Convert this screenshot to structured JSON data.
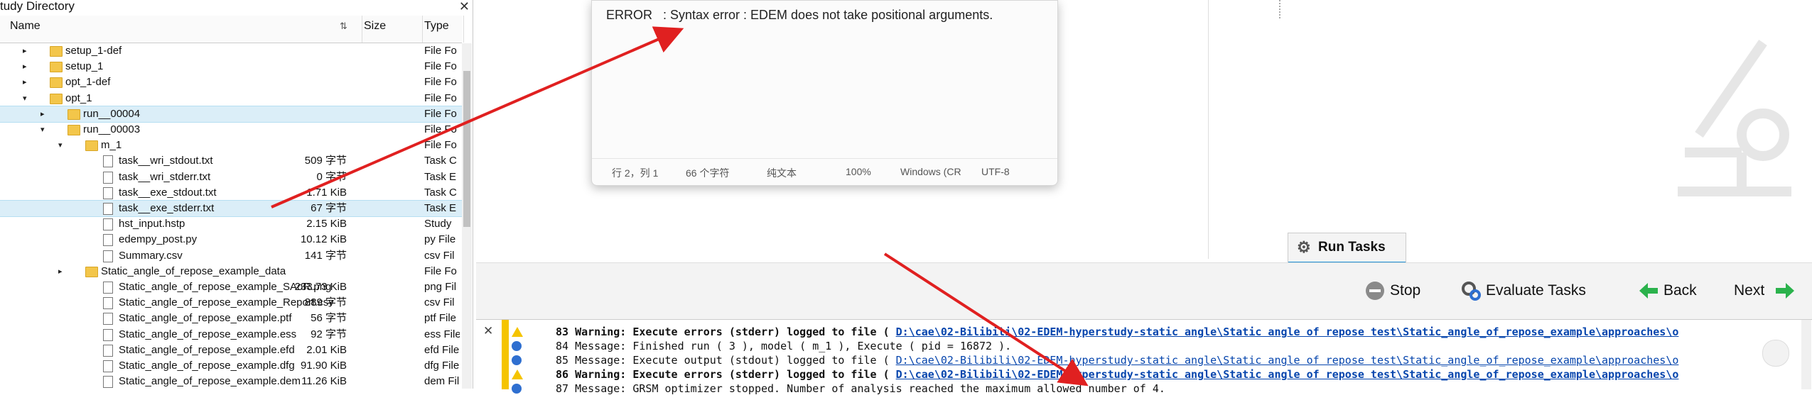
{
  "study_panel": {
    "title": "tudy Directory",
    "close_glyph": "✕",
    "columns": [
      "Name",
      "Size",
      "Type"
    ],
    "rows": [
      {
        "depth": 0,
        "toggle": "▸",
        "icon": "folder",
        "name": "setup_1-def",
        "size": "",
        "type": "File Fo"
      },
      {
        "depth": 0,
        "toggle": "▸",
        "icon": "folder",
        "name": "setup_1",
        "size": "",
        "type": "File Fo"
      },
      {
        "depth": 0,
        "toggle": "▸",
        "icon": "folder",
        "name": "opt_1-def",
        "size": "",
        "type": "File Fo"
      },
      {
        "depth": 0,
        "toggle": "▾",
        "icon": "folder",
        "name": "opt_1",
        "size": "",
        "type": "File Fo"
      },
      {
        "depth": 1,
        "toggle": "▸",
        "icon": "folder",
        "name": "run__00004",
        "size": "",
        "type": "File Fo",
        "selected": true
      },
      {
        "depth": 1,
        "toggle": "▾",
        "icon": "folder",
        "name": "run__00003",
        "size": "",
        "type": "File Fo"
      },
      {
        "depth": 2,
        "toggle": "▾",
        "icon": "folder",
        "name": "m_1",
        "size": "",
        "type": "File Fo"
      },
      {
        "depth": 3,
        "toggle": "",
        "icon": "file",
        "name": "task__wri_stdout.txt",
        "size": "509 字节",
        "type": "Task C"
      },
      {
        "depth": 3,
        "toggle": "",
        "icon": "file",
        "name": "task__wri_stderr.txt",
        "size": "0 字节",
        "type": "Task E"
      },
      {
        "depth": 3,
        "toggle": "",
        "icon": "file",
        "name": "task__exe_stdout.txt",
        "size": "1.71 KiB",
        "type": "Task C"
      },
      {
        "depth": 3,
        "toggle": "",
        "icon": "file",
        "name": "task__exe_stderr.txt",
        "size": "67 字节",
        "type": "Task E",
        "selected": true
      },
      {
        "depth": 3,
        "toggle": "",
        "icon": "file",
        "name": "hst_input.hstp",
        "size": "2.15 KiB",
        "type": "Study"
      },
      {
        "depth": 3,
        "toggle": "",
        "icon": "file",
        "name": "edempy_post.py",
        "size": "10.12 KiB",
        "type": "py File"
      },
      {
        "depth": 3,
        "toggle": "",
        "icon": "file",
        "name": "Summary.csv",
        "size": "141 字节",
        "type": "csv Fil"
      },
      {
        "depth": 2,
        "toggle": "▸",
        "icon": "folder",
        "name": "Static_angle_of_repose_example_data",
        "size": "",
        "type": "File Fo"
      },
      {
        "depth": 3,
        "toggle": "",
        "icon": "file",
        "name": "Static_angle_of_repose_example_SAoR.png",
        "size": "233.73 KiB",
        "type": "png Fil"
      },
      {
        "depth": 3,
        "toggle": "",
        "icon": "file",
        "name": "Static_angle_of_repose_example_Report.csv",
        "size": "889 字节",
        "type": "csv Fil"
      },
      {
        "depth": 3,
        "toggle": "",
        "icon": "file",
        "name": "Static_angle_of_repose_example.ptf",
        "size": "56 字节",
        "type": "ptf File"
      },
      {
        "depth": 3,
        "toggle": "",
        "icon": "file",
        "name": "Static_angle_of_repose_example.ess",
        "size": "92 字节",
        "type": "ess File"
      },
      {
        "depth": 3,
        "toggle": "",
        "icon": "file",
        "name": "Static_angle_of_repose_example.efd",
        "size": "2.01 KiB",
        "type": "efd File"
      },
      {
        "depth": 3,
        "toggle": "",
        "icon": "file",
        "name": "Static_angle_of_repose_example.dfg",
        "size": "91.90 KiB",
        "type": "dfg File"
      },
      {
        "depth": 3,
        "toggle": "",
        "icon": "file",
        "name": "Static_angle_of_repose_example.dem",
        "size": "11.26 KiB",
        "type": "dem Fil"
      }
    ]
  },
  "notepad": {
    "text": "ERROR   : Syntax error : EDEM does not take positional arguments.",
    "status": [
      "行 2，列 1",
      "66 个字符",
      "纯文本",
      "100%",
      "Windows (CR",
      "UTF-8"
    ]
  },
  "run_tab": {
    "label": "Run Tasks"
  },
  "toolbar": {
    "stop": "Stop",
    "evaluate": "Evaluate Tasks",
    "back": "Back",
    "next": "Next"
  },
  "log": [
    {
      "kind": "warning",
      "bold": true,
      "text": "83 Warning: Execute errors (stderr) logged to file ( ",
      "link": "D:\\cae\\02-Bilibili\\02-EDEM-hyperstudy-static angle\\Static angle of repose test\\Static_angle_of_repose_example\\approaches\\o"
    },
    {
      "kind": "info",
      "bold": false,
      "text": "84 Message: Finished run ( 3 ), model ( m_1 ), Execute ( pid = 16872 ).",
      "link": ""
    },
    {
      "kind": "info",
      "bold": false,
      "text": "85 Message: Execute output (stdout) logged to file ( ",
      "link": "D:\\cae\\02-Bilibili\\02-EDEM-hyperstudy-static angle\\Static angle of repose test\\Static_angle_of_repose_example\\approaches\\o"
    },
    {
      "kind": "warning",
      "bold": true,
      "text": "86 Warning: Execute errors (stderr) logged to file ( ",
      "link": "D:\\cae\\02-Bilibili\\02-EDEM-hyperstudy-static angle\\Static angle of repose test\\Static_angle_of_repose_example\\approaches\\o"
    },
    {
      "kind": "info",
      "bold": false,
      "text": "87 Message: GRSM optimizer stopped. Number of analysis reached the maximum allowed number of 4.",
      "link": ""
    }
  ],
  "colors": {
    "arrow": "#e02020",
    "accent": "#1e90d6",
    "link": "#0645ad",
    "selection": "#dbeef8",
    "warning": "#f5c400",
    "info": "#2f6fd0"
  }
}
